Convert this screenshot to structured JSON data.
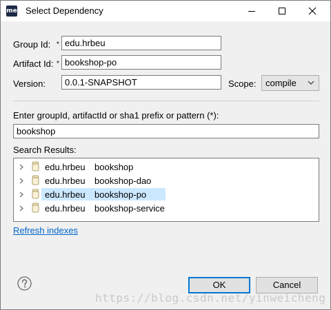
{
  "window": {
    "app_icon_text": "me",
    "title": "Select Dependency"
  },
  "form": {
    "group_id_label": "Group Id:",
    "group_id_value": "edu.hrbeu",
    "artifact_id_label": "Artifact Id:",
    "artifact_id_value": "bookshop-po",
    "required_marker": "*",
    "version_label": "Version:",
    "version_value": "0.0.1-SNAPSHOT",
    "scope_label": "Scope:",
    "scope_value": "compile"
  },
  "search": {
    "prompt_label": "Enter groupId, artifactId or sha1 prefix or pattern (*):",
    "query": "bookshop",
    "results_label": "Search Results:",
    "results": [
      {
        "group": "edu.hrbeu",
        "artifact": "bookshop",
        "selected": false
      },
      {
        "group": "edu.hrbeu",
        "artifact": "bookshop-dao",
        "selected": false
      },
      {
        "group": "edu.hrbeu",
        "artifact": "bookshop-po",
        "selected": true
      },
      {
        "group": "edu.hrbeu",
        "artifact": "bookshop-service",
        "selected": false
      }
    ],
    "refresh_link": "Refresh indexes"
  },
  "buttons": {
    "ok": "OK",
    "cancel": "Cancel"
  },
  "watermark": "https://blog.csdn.net/yinweicheng",
  "colors": {
    "selection": "#cce8ff",
    "link": "#0066cc",
    "default_button_border": "#0078d7"
  }
}
